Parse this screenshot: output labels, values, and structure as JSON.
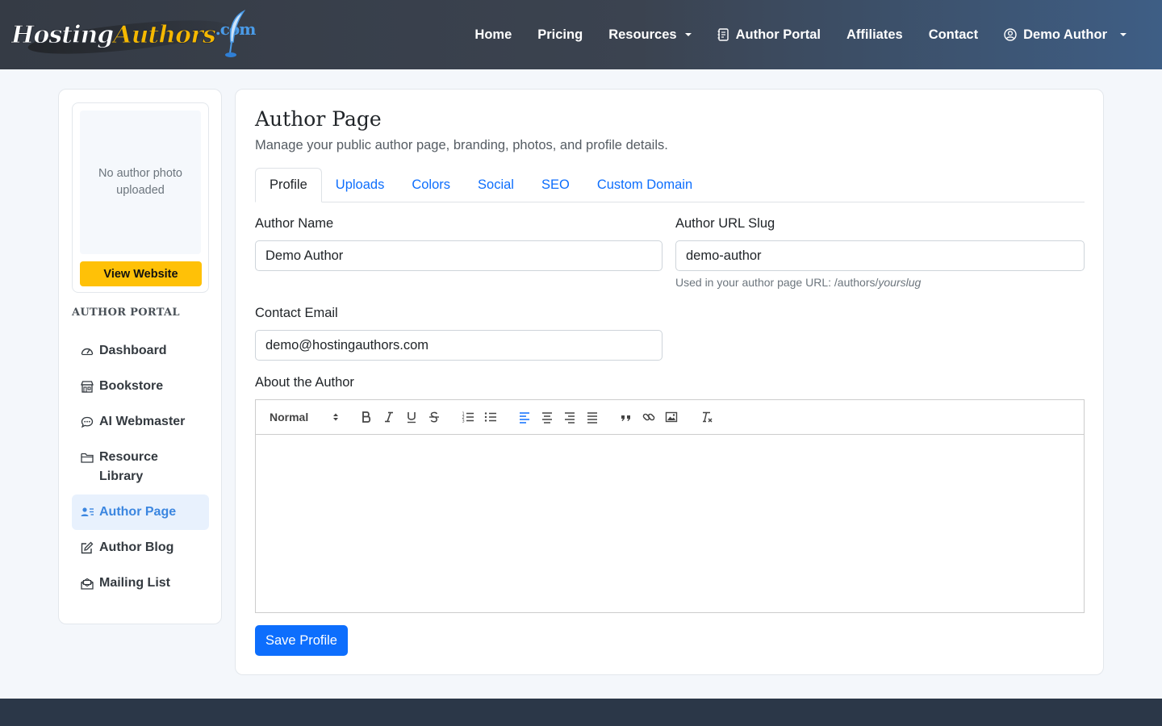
{
  "brand": {
    "part1": "Hosting",
    "part2": "Authors",
    "part3": ".com"
  },
  "nav": {
    "items": [
      {
        "label": "Home"
      },
      {
        "label": "Pricing"
      },
      {
        "label": "Resources"
      },
      {
        "label": "Author Portal"
      },
      {
        "label": "Affiliates"
      },
      {
        "label": "Contact"
      },
      {
        "label": "Demo Author"
      }
    ]
  },
  "sidebar": {
    "photo_placeholder": "No author photo uploaded",
    "view_website": "View Website",
    "heading": "AUTHOR PORTAL",
    "items": [
      {
        "label": "Dashboard",
        "icon": "dashboard-icon"
      },
      {
        "label": "Bookstore",
        "icon": "shop-icon"
      },
      {
        "label": "AI Webmaster",
        "icon": "chat-icon"
      },
      {
        "label": "Resource Library",
        "icon": "folder-icon"
      },
      {
        "label": "Author Page",
        "icon": "person-lines-icon",
        "active": true
      },
      {
        "label": "Author Blog",
        "icon": "edit-icon"
      },
      {
        "label": "Mailing List",
        "icon": "envelope-open-icon"
      }
    ]
  },
  "main": {
    "title": "Author Page",
    "subtitle": "Manage your public author page, branding, photos, and profile details.",
    "tabs": [
      {
        "label": "Profile",
        "active": true
      },
      {
        "label": "Uploads"
      },
      {
        "label": "Colors"
      },
      {
        "label": "Social"
      },
      {
        "label": "SEO"
      },
      {
        "label": "Custom Domain"
      }
    ],
    "author_name": {
      "label": "Author Name",
      "value": "Demo Author"
    },
    "slug": {
      "label": "Author URL Slug",
      "value": "demo-author",
      "help_prefix": "Used in your author page URL: /authors/",
      "help_slug": "yourslug"
    },
    "email": {
      "label": "Contact Email",
      "value": "demo@hostingauthors.com"
    },
    "about": {
      "label": "About the Author",
      "format": "Normal",
      "value": ""
    },
    "save_label": "Save Profile"
  },
  "colors": {
    "primary": "#0d6efd",
    "accent": "#ffc107",
    "active_nav": "#3b86e0",
    "footer": "#2b3748"
  }
}
